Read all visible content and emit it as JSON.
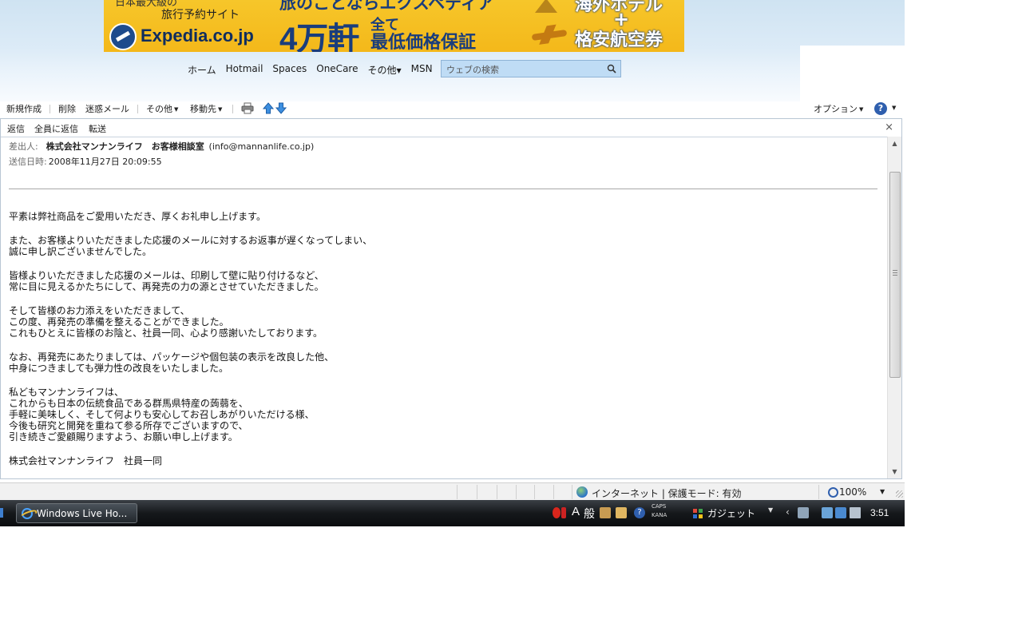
{
  "banner_ad": {
    "small_top": "日本最大級の",
    "subtitle": "旅行予約サイト",
    "logo": "Expedia.co.jp",
    "top_mid": "旅のことならエクスペディア",
    "big": "4万軒",
    "stack_1": "全て",
    "stack_2": "最低価格保証",
    "right_top": "海外ホテル",
    "plus": "+",
    "right_bottom": "格安航空券"
  },
  "nav": {
    "items": [
      "ホーム",
      "Hotmail",
      "Spaces",
      "OneCare"
    ],
    "more_label": "その他",
    "msn_label": "MSN",
    "search_placeholder": "ウェブの検索"
  },
  "toolbar": {
    "new_label": "新規作成",
    "delete_label": "削除",
    "junk_label": "迷惑メール",
    "more_label": "その他",
    "move_label": "移動先",
    "options_label": "オプション",
    "help_glyph": "?"
  },
  "reply_bar": {
    "reply_label": "返信",
    "reply_all_label": "全員に返信",
    "forward_label": "転送",
    "close_glyph": "×"
  },
  "message": {
    "from_label": "差出人:",
    "from_name": "株式会社マンナンライフ　お客様相談室",
    "from_email": "(info@mannanlife.co.jp)",
    "date_label": "送信日時:",
    "date_value": "2008年11月27日 20:09:55",
    "body_paragraphs": [
      [
        "平素は弊社商品をご愛用いただき、厚くお礼申し上げます。"
      ],
      [
        "また、お客様よりいただきました応援のメールに対するお返事が遅くなってしまい、",
        "誠に申し訳ございませんでした。"
      ],
      [
        "皆様よりいただきました応援のメールは、印刷して壁に貼り付けるなど、",
        "常に目に見えるかたちにして、再発売の力の源とさせていただきました。"
      ],
      [
        "そして皆様のお力添えをいただきまして、",
        "この度、再発売の準備を整えることができました。",
        "これもひとえに皆様のお陰と、社員一同、心より感謝いたしております。"
      ],
      [
        "なお、再発売にあたりましては、パッケージや個包装の表示を改良した他、",
        "中身につきましても弾力性の改良をいたしました。"
      ],
      [
        "私どもマンナンライフは、",
        "これからも日本の伝統食品である群馬県特産の蒟蒻を、",
        "手軽に美味しく、そして何よりも安心してお召しあがりいただける様、",
        "今後も研究と開発を重ねて参る所存でございますので、",
        "引き続きご愛顧賜りますよう、お願い申し上げます。"
      ],
      [
        "株式会社マンナンライフ　社員一同"
      ]
    ]
  },
  "status_bar": {
    "zone": "インターネット | 保護モード: 有効",
    "zoom": "100%"
  },
  "taskbar": {
    "task_label": "Windows Live Ho...",
    "ime_a": "A",
    "ime_mode": "般",
    "caps": "CAPS",
    "kana": "KANA",
    "gadget_label": "ガジェット",
    "clock": "3:51"
  }
}
